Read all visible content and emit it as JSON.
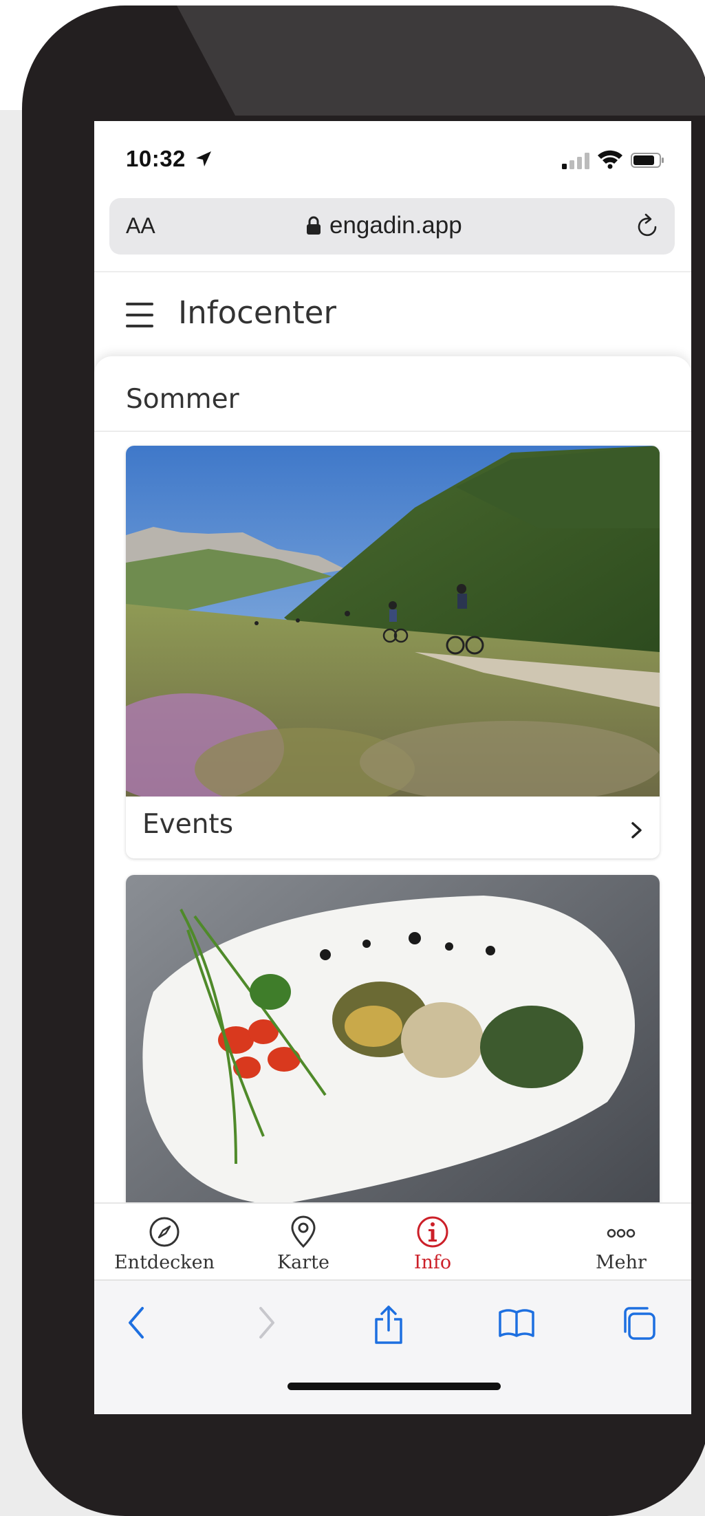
{
  "status_bar": {
    "time": "10:32"
  },
  "url_bar": {
    "text_size_label": "AA",
    "url": "engadin.app"
  },
  "header": {
    "title": "Infocenter"
  },
  "section": {
    "title": "Sommer"
  },
  "cards": [
    {
      "label": "Events",
      "image": "mountain-bikers-on-alpine-trail"
    },
    {
      "label": "",
      "image": "plated-dish-with-tomatoes-and-chives"
    }
  ],
  "tabs": [
    {
      "label": "Entdecken",
      "icon": "compass-icon",
      "active": false
    },
    {
      "label": "Karte",
      "icon": "map-pin-icon",
      "active": false
    },
    {
      "label": "Info",
      "icon": "info-icon",
      "active": true
    },
    {
      "label": "Mehr",
      "icon": "more-icon",
      "active": false
    }
  ],
  "colors": {
    "accent": "#cc2029",
    "ios_blue": "#1d6fe0",
    "phone_frame": "#231f20"
  }
}
